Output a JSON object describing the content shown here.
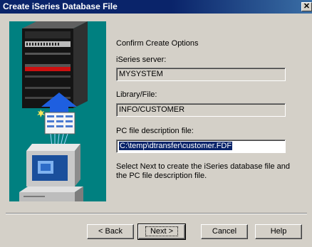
{
  "window": {
    "title": "Create iSeries Database File",
    "close_symbol": "✕"
  },
  "content": {
    "heading": "Confirm Create Options",
    "server_label": "iSeries server:",
    "server_value": "MYSYSTEM",
    "library_label": "Library/File:",
    "library_value": "INFO/CUSTOMER",
    "pcfile_label": "PC file description file:",
    "pcfile_value": "C:\\temp\\dtransfer\\customer.FDF",
    "instructions": "Select Next to create the iSeries database file and the PC file description file."
  },
  "buttons": {
    "back": "< Back",
    "next": "Next >",
    "cancel": "Cancel",
    "help": "Help"
  },
  "colors": {
    "title_bar": "#0a246a",
    "illustration_bg": "#008080",
    "arrow": "#1e5fe0"
  }
}
